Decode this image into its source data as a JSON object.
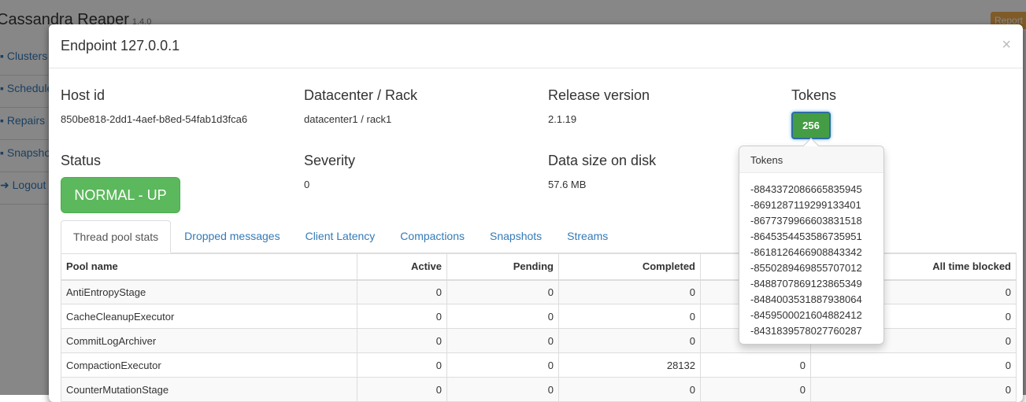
{
  "app": {
    "title": "Cassandra Reaper",
    "version": "1.4.0",
    "report_label": "Report"
  },
  "nav": [
    {
      "icon": "sitemap-icon",
      "label": "Clusters"
    },
    {
      "icon": "calendar-icon",
      "label": "Schedules"
    },
    {
      "icon": "wrench-icon",
      "label": "Repairs"
    },
    {
      "icon": "camera-icon",
      "label": "Snapshots"
    },
    {
      "icon": "logout-icon",
      "label": "Logout"
    }
  ],
  "modal": {
    "title": "Endpoint 127.0.0.1",
    "close": "×",
    "host_id": {
      "label": "Host id",
      "value": "850be818-2dd1-4aef-b8ed-54fab1d3fca6"
    },
    "dc_rack": {
      "label": "Datacenter / Rack",
      "value": "datacenter1 / rack1"
    },
    "release": {
      "label": "Release version",
      "value": "2.1.19"
    },
    "tokens": {
      "label": "Tokens",
      "count": "256"
    },
    "status": {
      "label": "Status",
      "value": "NORMAL - UP"
    },
    "severity": {
      "label": "Severity",
      "value": "0"
    },
    "data_size": {
      "label": "Data size on disk",
      "value": "57.6 MB"
    }
  },
  "tabs": [
    "Thread pool stats",
    "Dropped messages",
    "Client Latency",
    "Compactions",
    "Snapshots",
    "Streams"
  ],
  "table": {
    "headers": [
      "Pool name",
      "Active",
      "Pending",
      "Completed",
      "",
      "All time blocked"
    ],
    "rows": [
      [
        "AntiEntropyStage",
        "0",
        "0",
        "0",
        "",
        "0"
      ],
      [
        "CacheCleanupExecutor",
        "0",
        "0",
        "0",
        "",
        "0"
      ],
      [
        "CommitLogArchiver",
        "0",
        "0",
        "0",
        "",
        "0"
      ],
      [
        "CompactionExecutor",
        "0",
        "0",
        "28132",
        "0",
        "0"
      ],
      [
        "CounterMutationStage",
        "0",
        "0",
        "0",
        "0",
        "0"
      ]
    ]
  },
  "popover": {
    "title": "Tokens",
    "tokens": [
      "-8843372086665835945",
      "-8691287119299133401",
      "-8677379966603831518",
      "-8645354453586735951",
      "-8618126466908843342",
      "-8550289469855707012",
      "-8488707869123865349",
      "-8484003531887938064",
      "-8459500021604882412",
      "-8431839578027760287"
    ]
  },
  "colors": {
    "success": "#5cb85c",
    "link": "#337ab7",
    "warning": "#f0ad4e"
  }
}
